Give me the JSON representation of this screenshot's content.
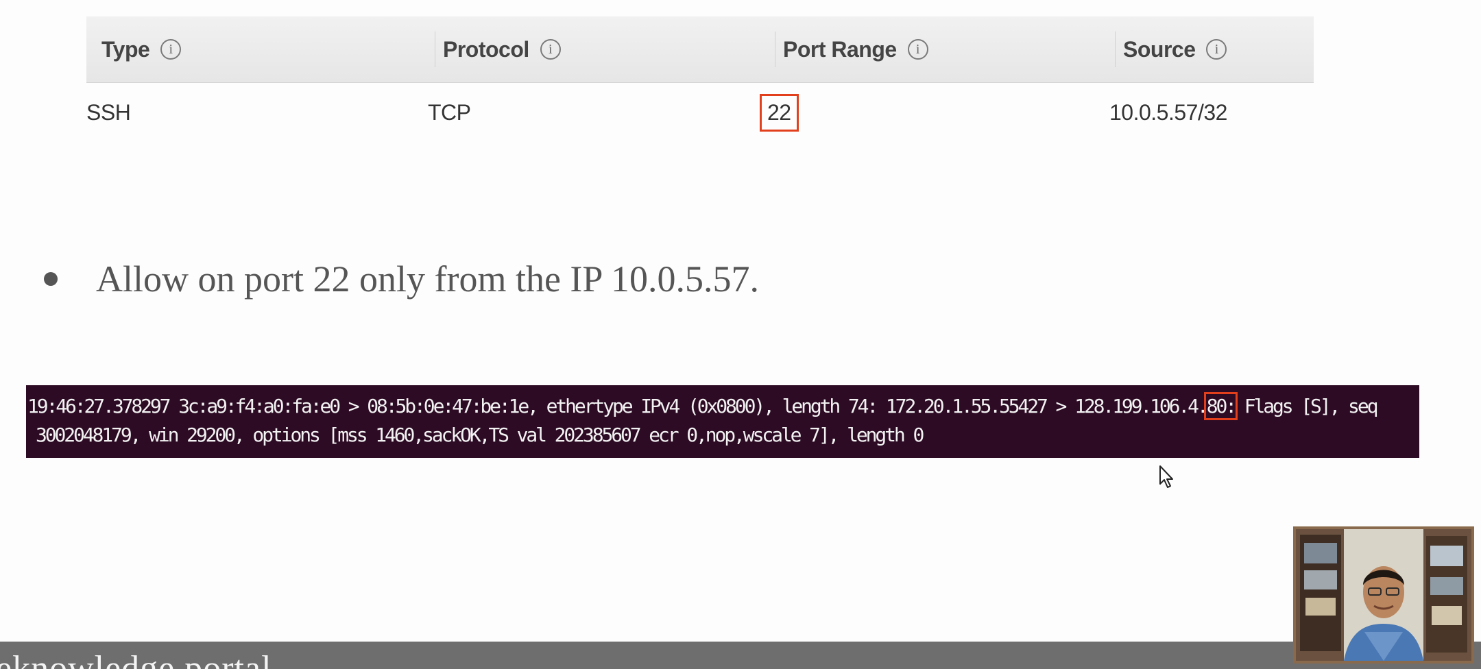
{
  "table": {
    "headers": [
      {
        "label": "Type",
        "info": "i"
      },
      {
        "label": "Protocol",
        "info": "i"
      },
      {
        "label": "Port Range",
        "info": "i"
      },
      {
        "label": "Source",
        "info": "i"
      }
    ],
    "row": {
      "type": "SSH",
      "protocol": "TCP",
      "port_range": "22",
      "source": "10.0.5.57/32"
    }
  },
  "bullet": {
    "text": "Allow on port 22 only from the IP 10.0.5.57."
  },
  "terminal": {
    "line1_before": "19:46:27.378297 3c:a9:f4:a0:fa:e0 > 08:5b:0e:47:be:1e, ethertype IPv4 (0x0800), length 74: 172.20.1.55.55427 > 128.199.106.4.",
    "line1_port": "80:",
    "line1_after": " Flags [S], seq",
    "line2": "3002048179, win 29200, options [mss 1460,sackOK,TS val 202385607 ecr 0,nop,wscale 7], length 0"
  },
  "brand": {
    "text": "eknowledge portal"
  },
  "colors": {
    "highlight": "#e2401d",
    "terminal_bg": "#2d0b24",
    "header_bg": "#e9e9e9",
    "brand_bar": "#6e6e6e"
  },
  "icons": [
    "info-icon",
    "mouse-cursor-icon",
    "bullet-dot-icon"
  ]
}
